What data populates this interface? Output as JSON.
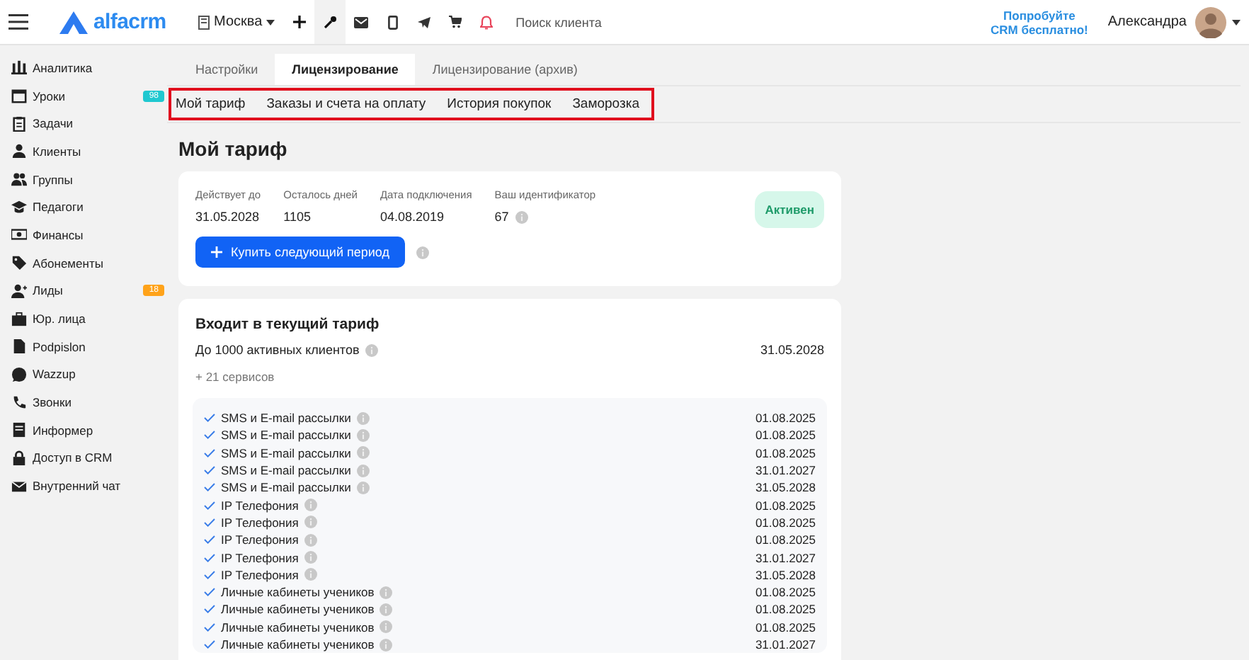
{
  "header": {
    "logo": "alfacrm",
    "branch": "Москва",
    "search": {
      "placeholder": "Поиск клиента"
    },
    "promo": [
      "Попробуйте",
      "CRM бесплатно!"
    ],
    "user": "Александра"
  },
  "sidebar": {
    "items": [
      {
        "label": "Аналитика"
      },
      {
        "label": "Уроки",
        "badge": "98",
        "color": "#1fc8d0"
      },
      {
        "label": "Задачи"
      },
      {
        "label": "Клиенты"
      },
      {
        "label": "Группы"
      },
      {
        "label": "Педагоги"
      },
      {
        "label": "Финансы"
      },
      {
        "label": "Абонементы"
      },
      {
        "label": "Лиды",
        "badge": "18",
        "color": "#ffa31a"
      },
      {
        "label": "Юр. лица"
      },
      {
        "label": "Podpislon"
      },
      {
        "label": "Wazzup"
      },
      {
        "label": "Звонки"
      },
      {
        "label": "Информер"
      },
      {
        "label": "Доступ в CRM"
      },
      {
        "label": "Внутренний чат"
      }
    ]
  },
  "tabs": [
    {
      "label": "Настройки",
      "selected": false
    },
    {
      "label": "Лицензирование",
      "selected": true
    },
    {
      "label": "Лицензирование (архив)",
      "selected": false
    }
  ],
  "subtabs": {
    "highlighted": true,
    "items": [
      "Мой тариф",
      "Заказы и счета на оплату",
      "История покупок",
      "Заморозка"
    ]
  },
  "title": "Мой тариф",
  "plan": {
    "fields": [
      {
        "label": "Действует до",
        "value": "31.05.2028",
        "info": false
      },
      {
        "label": "Осталось дней",
        "value": "1105",
        "info": false
      },
      {
        "label": "Дата подключения",
        "value": "04.08.2019",
        "info": false
      },
      {
        "label": "Ваш идентификатор",
        "value": "67",
        "info": true
      }
    ],
    "status": "Активен",
    "buy_button": "Купить следующий период"
  },
  "included": {
    "title": "Входит в текущий тариф",
    "main": {
      "label": "До 1000 активных клиентов",
      "date": "31.05.2028"
    },
    "more": "+ 21 сервисов",
    "services": [
      {
        "name": "SMS и E-mail рассылки",
        "date": "01.08.2025"
      },
      {
        "name": "SMS и E-mail рассылки",
        "date": "01.08.2025"
      },
      {
        "name": "SMS и E-mail рассылки",
        "date": "01.08.2025"
      },
      {
        "name": "SMS и E-mail рассылки",
        "date": "31.01.2027"
      },
      {
        "name": "SMS и E-mail рассылки",
        "date": "31.05.2028"
      },
      {
        "name": "IP Телефония",
        "date": "01.08.2025"
      },
      {
        "name": "IP Телефония",
        "date": "01.08.2025"
      },
      {
        "name": "IP Телефония",
        "date": "01.08.2025"
      },
      {
        "name": "IP Телефония",
        "date": "31.01.2027"
      },
      {
        "name": "IP Телефония",
        "date": "31.05.2028"
      },
      {
        "name": "Личные кабинеты учеников",
        "date": "01.08.2025"
      },
      {
        "name": "Личные кабинеты учеников",
        "date": "01.08.2025"
      },
      {
        "name": "Личные кабинеты учеников",
        "date": "01.08.2025"
      },
      {
        "name": "Личные кабинеты учеников",
        "date": "31.01.2027"
      }
    ]
  }
}
